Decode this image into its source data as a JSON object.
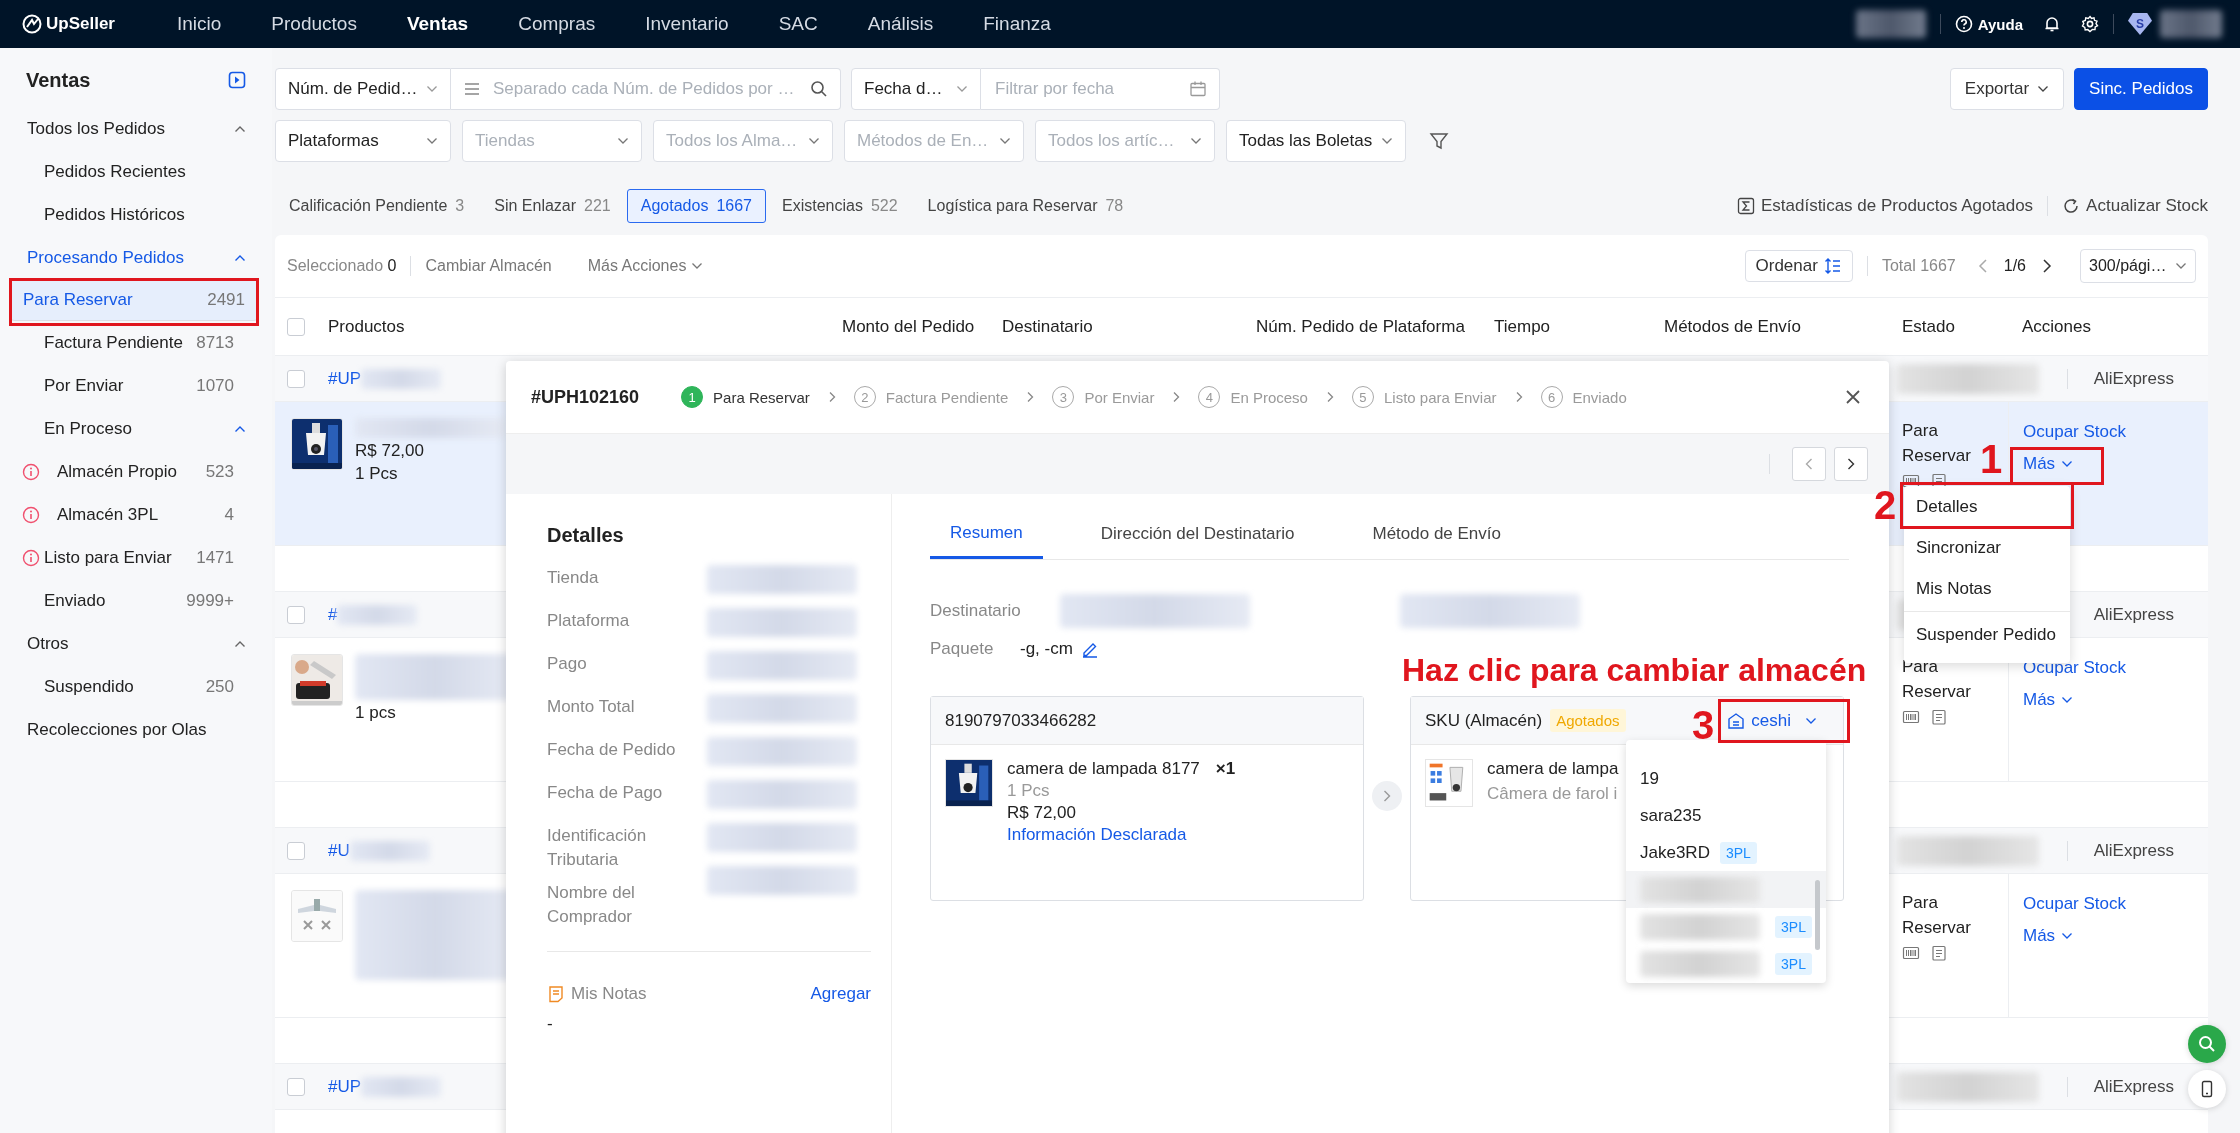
{
  "top_nav": {
    "logo": "UpSeller",
    "items": [
      {
        "label": "Inicio",
        "selected": false
      },
      {
        "label": "Productos",
        "selected": false
      },
      {
        "label": "Ventas",
        "selected": true
      },
      {
        "label": "Compras",
        "selected": false
      },
      {
        "label": "Inventario",
        "selected": false
      },
      {
        "label": "SAC",
        "selected": false
      },
      {
        "label": "Análisis",
        "selected": false
      },
      {
        "label": "Finanza",
        "selected": false
      }
    ],
    "help": "Ayuda",
    "badge_letter": "S"
  },
  "sidebar": {
    "title": "Ventas",
    "items": [
      {
        "label": "Todos los Pedidos",
        "active": false,
        "expanded": true,
        "children": [
          {
            "label": "Pedidos Recientes",
            "selected": false,
            "alert": false
          },
          {
            "label": "Pedidos Históricos",
            "selected": false,
            "alert": false
          }
        ]
      },
      {
        "label": "Procesando Pedidos",
        "active": true,
        "expanded": true,
        "children": [
          {
            "label": "Para Reservar",
            "count": "2491",
            "selected": true,
            "alert": false
          },
          {
            "label": "Factura Pendiente",
            "count": "8713",
            "selected": false,
            "alert": false
          },
          {
            "label": "Por Enviar",
            "count": "1070",
            "selected": false,
            "alert": false
          },
          {
            "label": "En Proceso",
            "expanded": true,
            "children": [
              {
                "label": "Almacén Propio",
                "count": "523",
                "selected": false,
                "alert": true
              },
              {
                "label": "Almacén 3PL",
                "count": "4",
                "selected": false,
                "alert": true
              }
            ]
          },
          {
            "label": "Listo para Enviar",
            "count": "1471",
            "selected": false,
            "alert": true
          },
          {
            "label": "Enviado",
            "count": "9999+",
            "selected": false,
            "alert": false
          }
        ]
      },
      {
        "label": "Otros",
        "active": false,
        "expanded": true,
        "children": [
          {
            "label": "Suspendido",
            "count": "250",
            "selected": false,
            "alert": false
          }
        ]
      },
      {
        "label": "Recolecciones por Olas",
        "active": false
      }
    ]
  },
  "search_bar": {
    "type_select": "Núm. de Pedid…",
    "search_placeholder": "Separado cada Núm. de Pedidos por …",
    "date_select": "Fecha d…",
    "date_placeholder": "Filtrar por fecha",
    "export": "Exportar",
    "sync": "Sinc. Pedidos"
  },
  "filter_selects": [
    {
      "value": "Plataformas"
    },
    {
      "placeholder": "Tiendas"
    },
    {
      "placeholder": "Todos los Alma…"
    },
    {
      "placeholder": "Métodos de En…"
    },
    {
      "placeholder": "Todos los artíc…"
    },
    {
      "value": "Todas las Boletas"
    }
  ],
  "status_tabs": [
    {
      "label": "Calificación Pendiente",
      "count": "3",
      "selected": false
    },
    {
      "label": "Sin Enlazar",
      "count": "221",
      "selected": false
    },
    {
      "label": "Agotados",
      "count": "1667",
      "selected": true
    },
    {
      "label": "Existencias",
      "count": "522",
      "selected": false
    },
    {
      "label": "Logística para Reservar",
      "count": "78",
      "selected": false
    }
  ],
  "stats_link": "Estadísticas de Productos Agotados",
  "refresh_link": "Actualizar Stock",
  "table": {
    "toolbar": {
      "selected_label": "Seleccionado",
      "selected_count": "0",
      "change_warehouse": "Cambiar Almacén",
      "more_actions": "Más Acciones",
      "sort": "Ordenar",
      "total": "Total 1667",
      "page": "1/6",
      "page_size": "300/pági…"
    },
    "select_all_checked": false,
    "columns": [
      "Productos",
      "Monto del Pedido",
      "Destinatario",
      "Núm. Pedido de Plataforma",
      "Tiempo",
      "Métodos de Envío",
      "Estado",
      "Acciones"
    ],
    "orders": [
      {
        "number": "#UP",
        "platform": "AliExpress",
        "checked": false,
        "highlighted": true,
        "price": "R$ 72,00",
        "quantity": "1 Pcs",
        "status": "Para Reservar",
        "action": "Ocupar Stock",
        "more": "Más"
      },
      {
        "number": "#",
        "platform": "AliExpress",
        "checked": false,
        "highlighted": false,
        "quantity": "1 pcs",
        "status": "Para Reservar",
        "action": "Ocupar Stock",
        "more": "Más"
      },
      {
        "number": "#U",
        "platform": "AliExpress",
        "checked": false,
        "highlighted": false,
        "status": "Para Reservar",
        "action": "Ocupar Stock",
        "more": "Más"
      },
      {
        "number": "#UP",
        "platform": "AliExpress",
        "checked": false
      }
    ]
  },
  "more_menu": [
    {
      "label": "Detalles",
      "divider_before": false
    },
    {
      "label": "Sincronizar",
      "divider_before": false
    },
    {
      "label": "Mis Notas",
      "divider_before": false
    },
    {
      "label": "Suspender Pedido",
      "divider_before": true
    }
  ],
  "modal": {
    "order_number": "#UPH102160",
    "steps": [
      {
        "number": "1",
        "label": "Para Reservar",
        "active": true
      },
      {
        "number": "2",
        "label": "Factura Pendiente",
        "active": false
      },
      {
        "number": "3",
        "label": "Por Enviar",
        "active": false
      },
      {
        "number": "4",
        "label": "En Proceso",
        "active": false
      },
      {
        "number": "5",
        "label": "Listo para Enviar",
        "active": false
      },
      {
        "number": "6",
        "label": "Enviado",
        "active": false
      }
    ],
    "details_title": "Detalles",
    "fields": [
      "Tienda",
      "Plataforma",
      "Pago",
      "Monto Total",
      "Fecha de Pedido",
      "Fecha de Pago",
      "Identificación Tributaria",
      "Nombre del Comprador"
    ],
    "notes_title": "Mis Notas",
    "notes_action": "Agregar",
    "notes_value": "-",
    "tabs": [
      {
        "label": "Resumen",
        "selected": true
      },
      {
        "label": "Dirección del Destinatario",
        "selected": false
      },
      {
        "label": "Método de Envío",
        "selected": false
      }
    ],
    "recipient_label": "Destinatario",
    "package_label": "Paquete",
    "package_value": "-g, -cm",
    "source_card": {
      "header": "8190797033466282",
      "name": "camera de lampada 8177",
      "qty": "×1",
      "units": "1 Pcs",
      "price": "R$ 72,00",
      "link": "Información Desclarada"
    },
    "target_card": {
      "header": "SKU (Almacén)",
      "badge": "Agotados",
      "warehouse": "ceshi",
      "name": "camera de lampa",
      "description": "Câmera de farol i"
    },
    "warehouse_options": [
      {
        "kind": "text",
        "label": "19",
        "highlighted": false
      },
      {
        "kind": "text",
        "label": "sara235",
        "highlighted": false
      },
      {
        "kind": "text",
        "label": "Jake3RD",
        "tag": "3PL",
        "highlighted": false
      },
      {
        "kind": "blurred",
        "highlighted": true
      },
      {
        "kind": "blurred",
        "tag": "3PL",
        "highlighted": false
      },
      {
        "kind": "blurred",
        "tag": "3PL",
        "highlighted": false
      }
    ]
  },
  "annotations": {
    "markers": [
      "1",
      "2",
      "3"
    ],
    "note": "Haz clic para cambiar almacén"
  }
}
